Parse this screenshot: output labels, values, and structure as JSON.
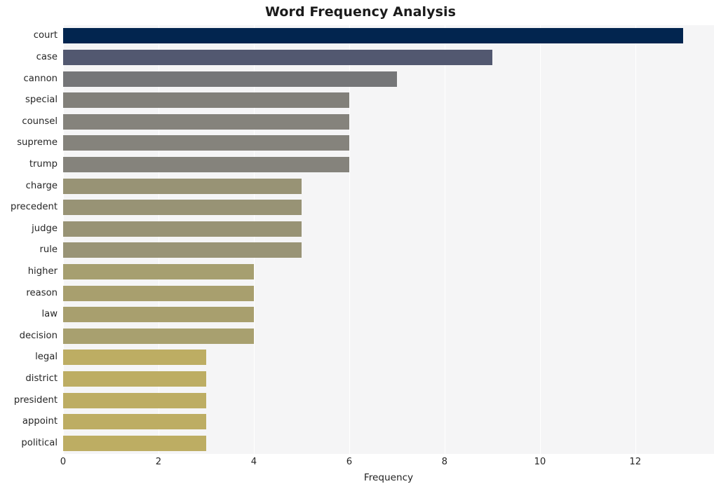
{
  "chart_data": {
    "type": "bar",
    "orientation": "horizontal",
    "title": "Word Frequency Analysis",
    "xlabel": "Frequency",
    "ylabel": "",
    "categories": [
      "court",
      "case",
      "cannon",
      "special",
      "counsel",
      "supreme",
      "trump",
      "charge",
      "precedent",
      "judge",
      "rule",
      "higher",
      "reason",
      "law",
      "decision",
      "legal",
      "district",
      "president",
      "appoint",
      "political"
    ],
    "values": [
      13,
      9,
      7,
      6,
      6,
      6,
      6,
      5,
      5,
      5,
      5,
      4,
      4,
      4,
      4,
      3,
      3,
      3,
      3,
      3
    ],
    "bar_colors": [
      "#02254f",
      "#525870",
      "#757678",
      "#82807a",
      "#85837c",
      "#85837c",
      "#85837c",
      "#989375",
      "#989375",
      "#989375",
      "#999476",
      "#a69f70",
      "#a89f6e",
      "#a89f6e",
      "#a8a06f",
      "#bdad63",
      "#bdad63",
      "#bdad63",
      "#bdad63",
      "#bdad63"
    ],
    "xticks": [
      0,
      2,
      4,
      6,
      8,
      10,
      12
    ],
    "xlim": [
      0,
      13.65
    ],
    "grid": true,
    "grid_color": "#ffffff",
    "plot_background": "#f5f5f6",
    "figure_background": "#ffffff",
    "legend": null
  }
}
